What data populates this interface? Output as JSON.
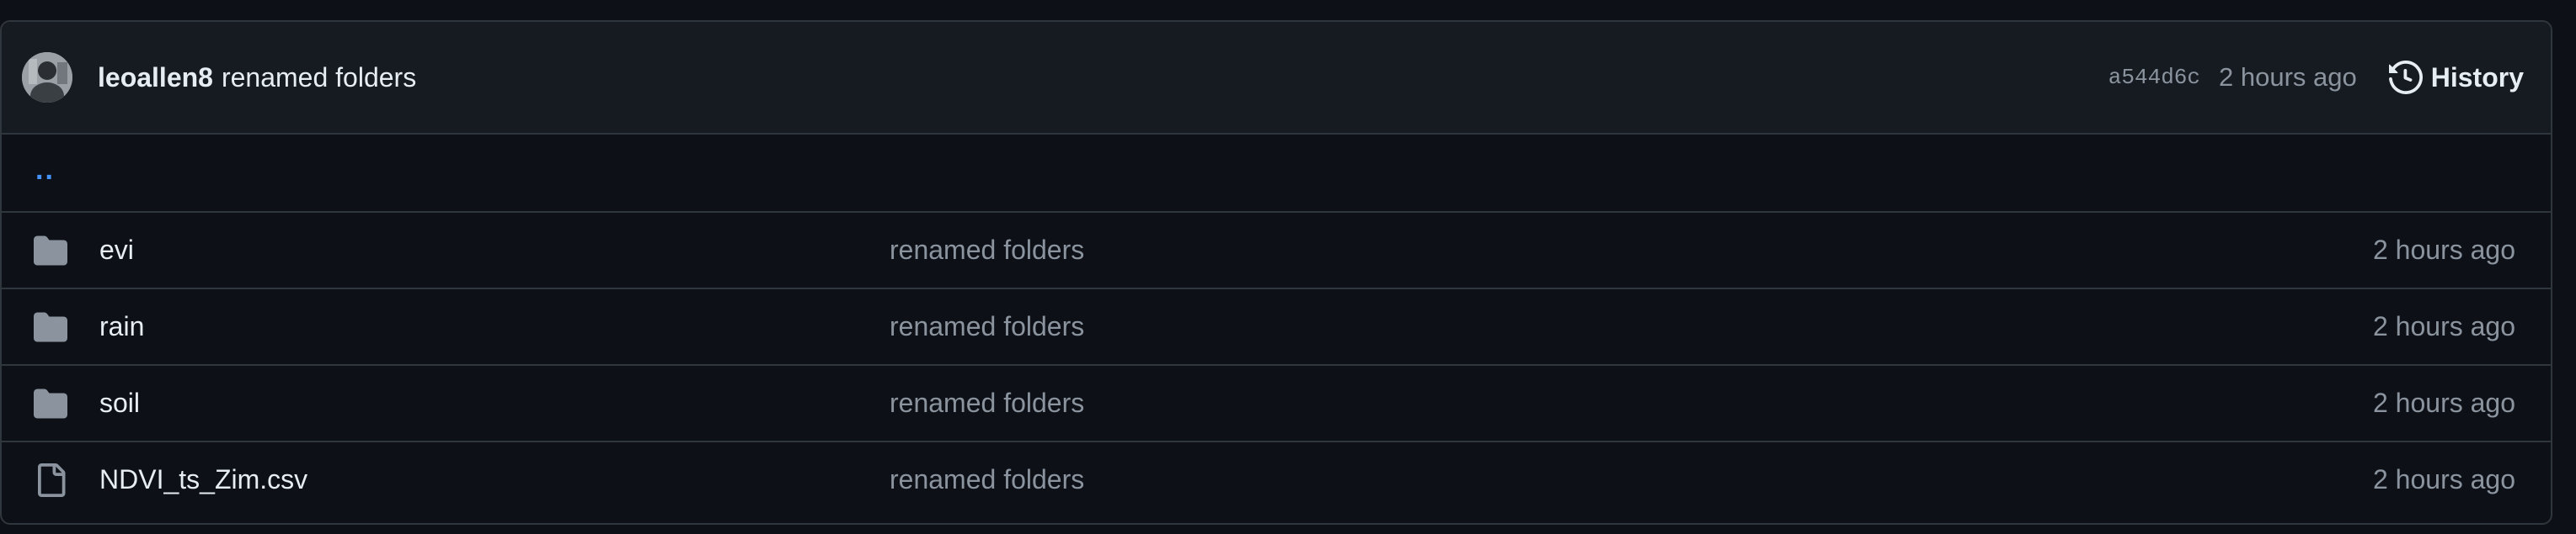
{
  "commit": {
    "author": "leoallen8",
    "message": "renamed folders",
    "sha": "a544d6c",
    "time": "2 hours ago",
    "history_label": "History"
  },
  "parent_dir": "..",
  "files": [
    {
      "name": "evi",
      "type": "folder",
      "message": "renamed folders",
      "time": "2 hours ago"
    },
    {
      "name": "rain",
      "type": "folder",
      "message": "renamed folders",
      "time": "2 hours ago"
    },
    {
      "name": "soil",
      "type": "folder",
      "message": "renamed folders",
      "time": "2 hours ago"
    },
    {
      "name": "NDVI_ts_Zim.csv",
      "type": "file",
      "message": "renamed folders",
      "time": "2 hours ago"
    }
  ],
  "colors": {
    "background": "#0d1117",
    "header": "#161b22",
    "border": "#30363d",
    "muted": "#8b949e",
    "link": "#4493f8"
  }
}
